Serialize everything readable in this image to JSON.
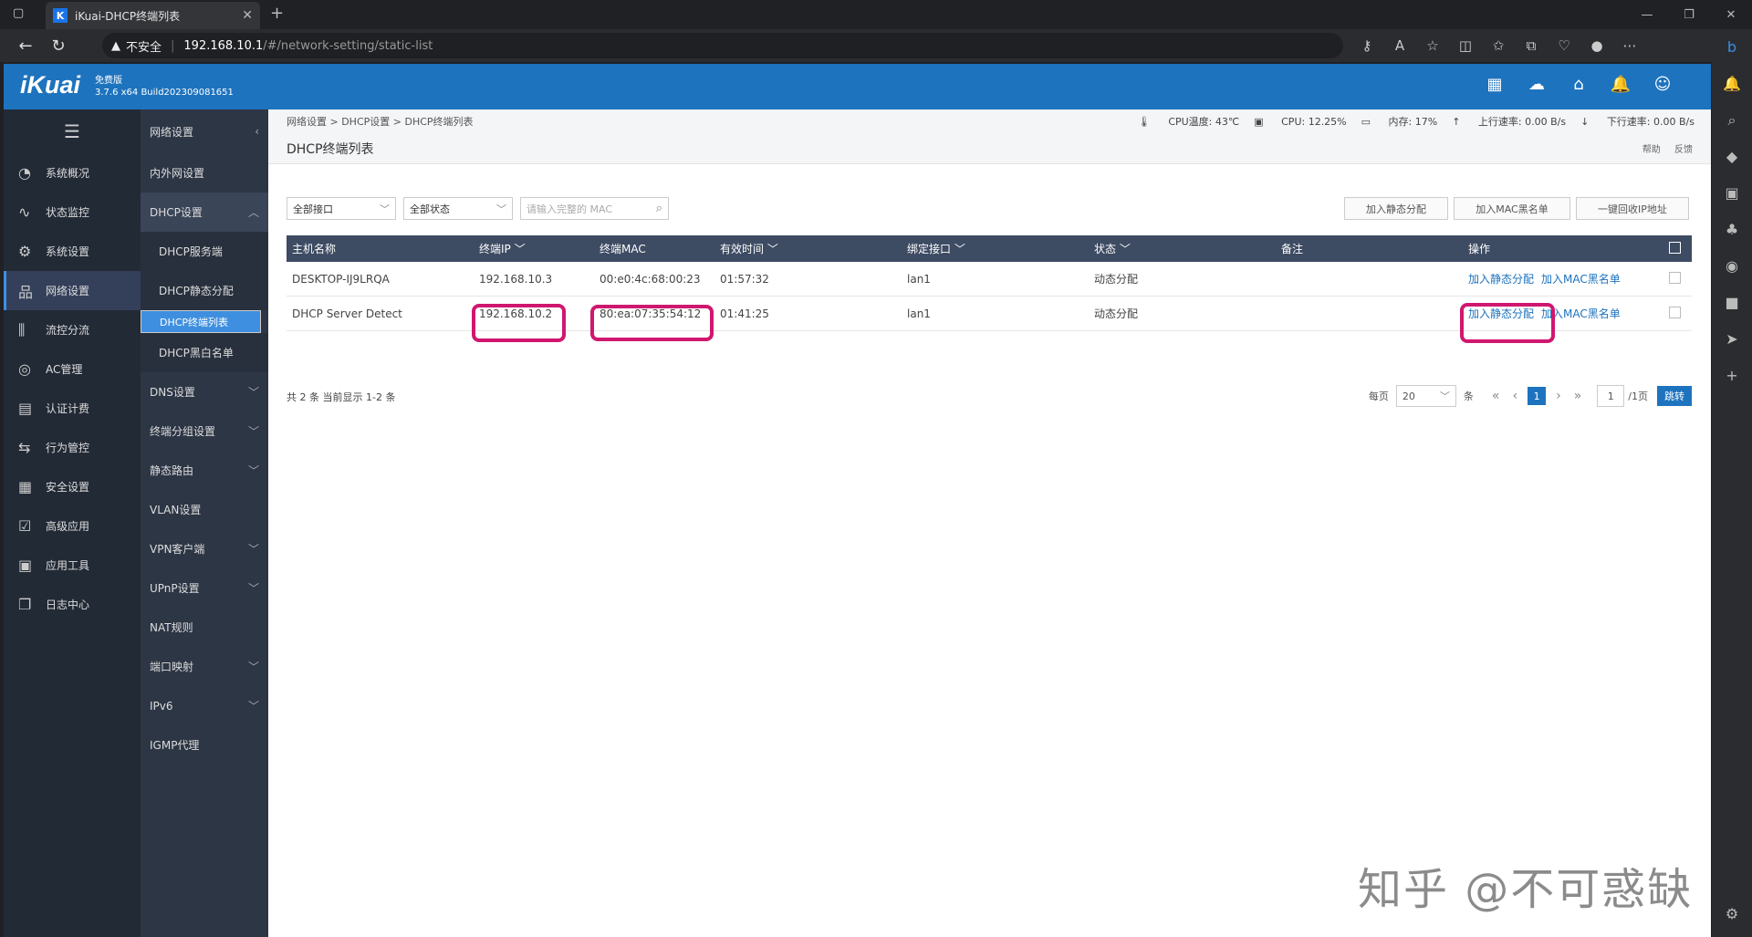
{
  "browser": {
    "tab_title": "iKuai-DHCP终端列表",
    "tab_icon_letter": "K",
    "insecure_label": "不安全",
    "url_host": "192.168.10.1",
    "url_path": "/#/network-setting/static-list"
  },
  "app": {
    "logo": "iKuai",
    "edition": "免费版",
    "version": "3.7.6 x64 Build202309081651"
  },
  "sidebar": {
    "items": [
      {
        "label": "系统概况",
        "icon": "dashboard-icon"
      },
      {
        "label": "状态监控",
        "icon": "monitor-icon"
      },
      {
        "label": "系统设置",
        "icon": "gear-icon"
      },
      {
        "label": "网络设置",
        "icon": "network-icon"
      },
      {
        "label": "流控分流",
        "icon": "sliders-icon"
      },
      {
        "label": "AC管理",
        "icon": "ac-icon"
      },
      {
        "label": "认证计费",
        "icon": "id-card-icon"
      },
      {
        "label": "行为管控",
        "icon": "arrows-icon"
      },
      {
        "label": "安全设置",
        "icon": "firewall-icon"
      },
      {
        "label": "高级应用",
        "icon": "checklist-icon"
      },
      {
        "label": "应用工具",
        "icon": "apps-icon"
      },
      {
        "label": "日志中心",
        "icon": "log-icon"
      }
    ]
  },
  "subnav": {
    "header": "网络设置",
    "items": [
      {
        "label": "内外网设置"
      },
      {
        "label": "DHCP设置"
      },
      {
        "label": "DHCP服务端"
      },
      {
        "label": "DHCP静态分配"
      },
      {
        "label": "DHCP终端列表"
      },
      {
        "label": "DHCP黑白名单"
      },
      {
        "label": "DNS设置"
      },
      {
        "label": "终端分组设置"
      },
      {
        "label": "静态路由"
      },
      {
        "label": "VLAN设置"
      },
      {
        "label": "VPN客户端"
      },
      {
        "label": "UPnP设置"
      },
      {
        "label": "NAT规则"
      },
      {
        "label": "端口映射"
      },
      {
        "label": "IPv6"
      },
      {
        "label": "IGMP代理"
      }
    ]
  },
  "breadcrumb": "网络设置 > DHCP设置 > DHCP终端列表",
  "stats": {
    "cpu_temp": "CPU温度: 43℃",
    "cpu": "CPU: 12.25%",
    "mem": "内存: 17%",
    "up": "上行速率: 0.00 B/s",
    "down": "下行速率: 0.00 B/s"
  },
  "page": {
    "title": "DHCP终端列表",
    "help": "帮助",
    "feedback": "反馈"
  },
  "filters": {
    "interface": "全部接口",
    "status": "全部状态",
    "search_placeholder": "请输入完整的 MAC"
  },
  "actions": {
    "add_static": "加入静态分配",
    "add_mac_black": "加入MAC黑名单",
    "reclaim_ip": "一键回收IP地址"
  },
  "table": {
    "columns": [
      "主机名称",
      "终端IP",
      "终端MAC",
      "有效时间",
      "绑定接口",
      "状态",
      "备注",
      "操作"
    ],
    "rows": [
      {
        "host": "DESKTOP-IJ9LRQA",
        "ip": "192.168.10.3",
        "mac": "00:e0:4c:68:00:23",
        "lease": "01:57:32",
        "iface": "lan1",
        "status": "动态分配",
        "note": "",
        "op1": "加入静态分配",
        "op2": "加入MAC黑名单"
      },
      {
        "host": "DHCP Server Detect",
        "ip": "192.168.10.2",
        "mac": "80:ea:07:35:54:12",
        "lease": "01:41:25",
        "iface": "lan1",
        "status": "动态分配",
        "note": "",
        "op1": "加入静态分配",
        "op2": "加入MAC黑名单"
      }
    ]
  },
  "footer": {
    "summary": "共 2 条 当前显示 1-2 条",
    "per_page_label": "每页",
    "per_page": "20",
    "unit": "条",
    "current_page": "1",
    "page_input": "1",
    "total_pages": "/1页",
    "go": "跳转"
  },
  "watermark": "知乎 @不可惑缺"
}
